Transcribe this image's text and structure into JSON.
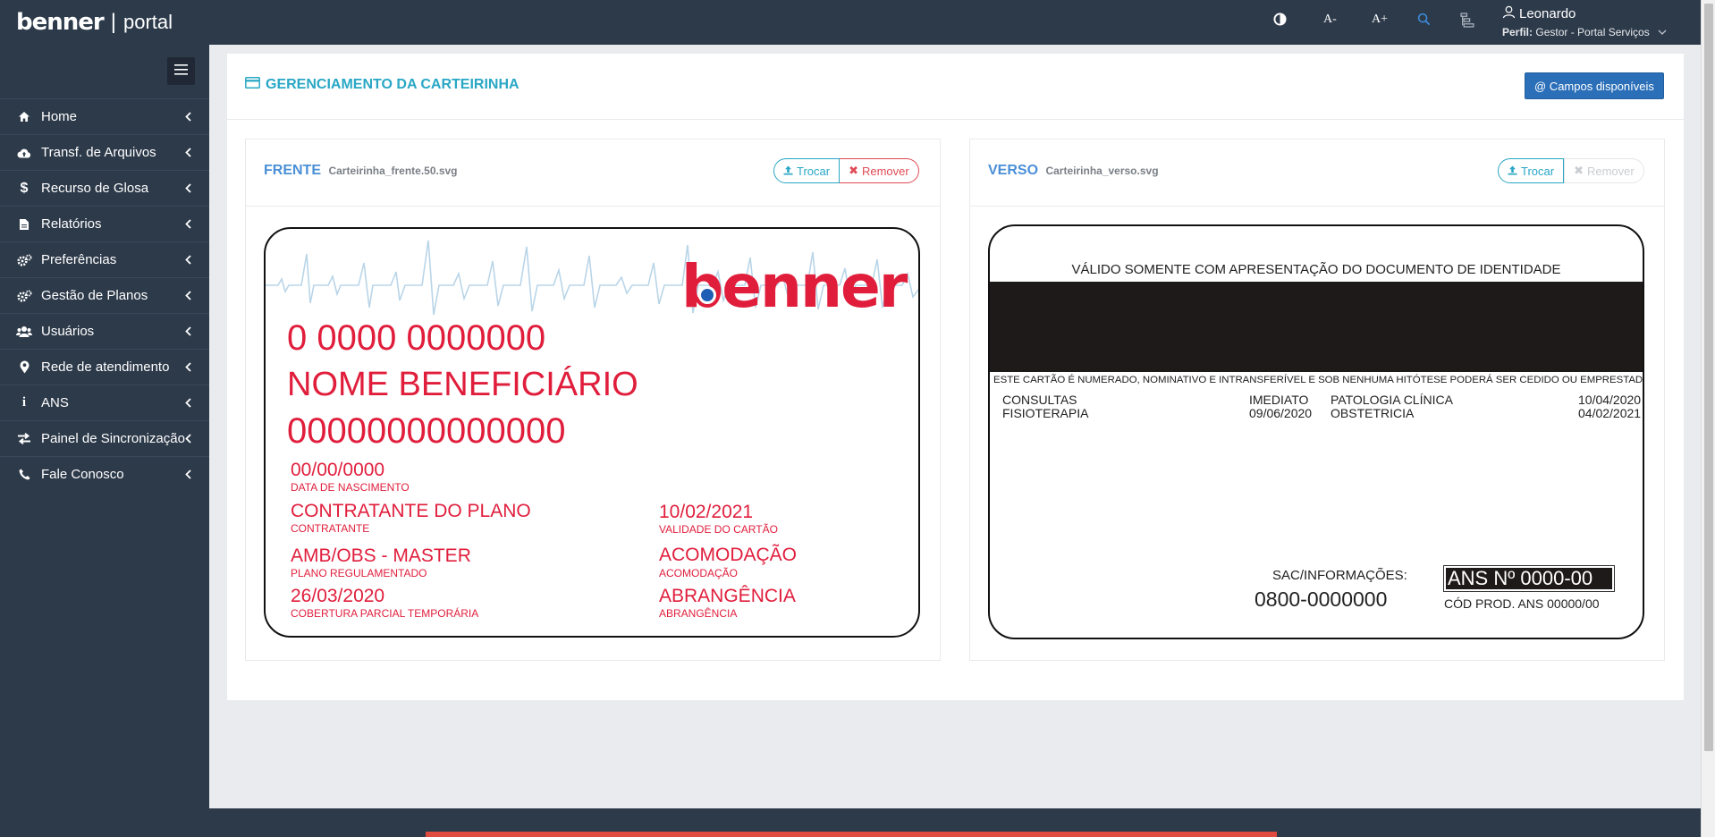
{
  "header": {
    "brand": "benner",
    "portal": "portal",
    "tools": {
      "font_decrease": "A-",
      "font_increase": "A+"
    },
    "user": {
      "name": "Leonardo",
      "profile_label": "Perfil:",
      "profile_value": "Gestor - Portal Serviços"
    }
  },
  "sidebar": {
    "items": [
      {
        "label": "Home",
        "icon": "home-icon"
      },
      {
        "label": "Transf. de Arquivos",
        "icon": "cloud-icon"
      },
      {
        "label": "Recurso de Glosa",
        "icon": "dollar-icon"
      },
      {
        "label": "Relatórios",
        "icon": "file-icon"
      },
      {
        "label": "Preferências",
        "icon": "gears-icon"
      },
      {
        "label": "Gestão de Planos",
        "icon": "gears-icon"
      },
      {
        "label": "Usuários",
        "icon": "users-icon"
      },
      {
        "label": "Rede de atendimento",
        "icon": "map-marker-icon"
      },
      {
        "label": "ANS",
        "icon": "info-icon"
      },
      {
        "label": "Painel de Sincronização",
        "icon": "exchange-icon"
      },
      {
        "label": "Fale Conosco",
        "icon": "phone-icon"
      }
    ]
  },
  "main": {
    "title": "GERENCIAMENTO DA CARTEIRINHA",
    "campos_button": "@ Campos disponíveis",
    "front": {
      "label": "FRENTE",
      "file": "Carteirinha_frente.50.svg",
      "trocar": "Trocar",
      "remover": "Remover",
      "card": {
        "logo": "benner",
        "number": "0 0000 0000000",
        "name": "NOME BENEFICIÁRIO",
        "code": "00000000000000",
        "birth_value": "00/00/0000",
        "birth_label": "DATA DE NASCIMENTO",
        "contractor_value": "CONTRATANTE DO PLANO",
        "contractor_label": "CONTRATANTE",
        "validity_value": "10/02/2021",
        "validity_label": "VALIDADE DO CARTÃO",
        "plan_value": "AMB/OBS - MASTER",
        "plan_label": "PLANO REGULAMENTADO",
        "accommodation_value": "ACOMODAÇÃO",
        "accommodation_label": "ACOMODAÇÃO",
        "coverage_value": "26/03/2020",
        "coverage_label": "COBERTURA PARCIAL TEMPORÁRIA",
        "scope_value": "ABRANGÊNCIA",
        "scope_label": "ABRANGÊNCIA"
      }
    },
    "back": {
      "label": "VERSO",
      "file": "Carteirinha_verso.svg",
      "trocar": "Trocar",
      "remover": "Remover",
      "card": {
        "valid_text": "VÁLIDO SOMENTE COM APRESENTAÇÃO DO DOCUMENTO DE IDENTIDADE",
        "notice": "ESTE CARTÃO É NUMERADO, NOMINATIVO E INTRANSFERÍVEL E SOB NENHUMA HITÓTESE PODERÁ SER CEDIDO OU EMPRESTADO.",
        "rows": [
          {
            "service": "CONSULTAS",
            "date": "IMEDIATO",
            "service2": "PATOLOGIA CLÍNICA",
            "date2": "10/04/2020"
          },
          {
            "service": "FISIOTERAPIA",
            "date": "09/06/2020",
            "service2": "OBSTETRICIA",
            "date2": "04/02/2021"
          }
        ],
        "sac_label": "SAC/INFORMAÇÕES:",
        "phone": "0800-0000000",
        "ans": "ANS Nº 0000-00",
        "cod": "CÓD PROD. ANS 00000/00"
      }
    }
  },
  "colors": {
    "accent": "#29a7c5",
    "brand_red": "#e01e3c",
    "primary": "#2a6fb8",
    "sidebar": "#2d3a4a"
  }
}
